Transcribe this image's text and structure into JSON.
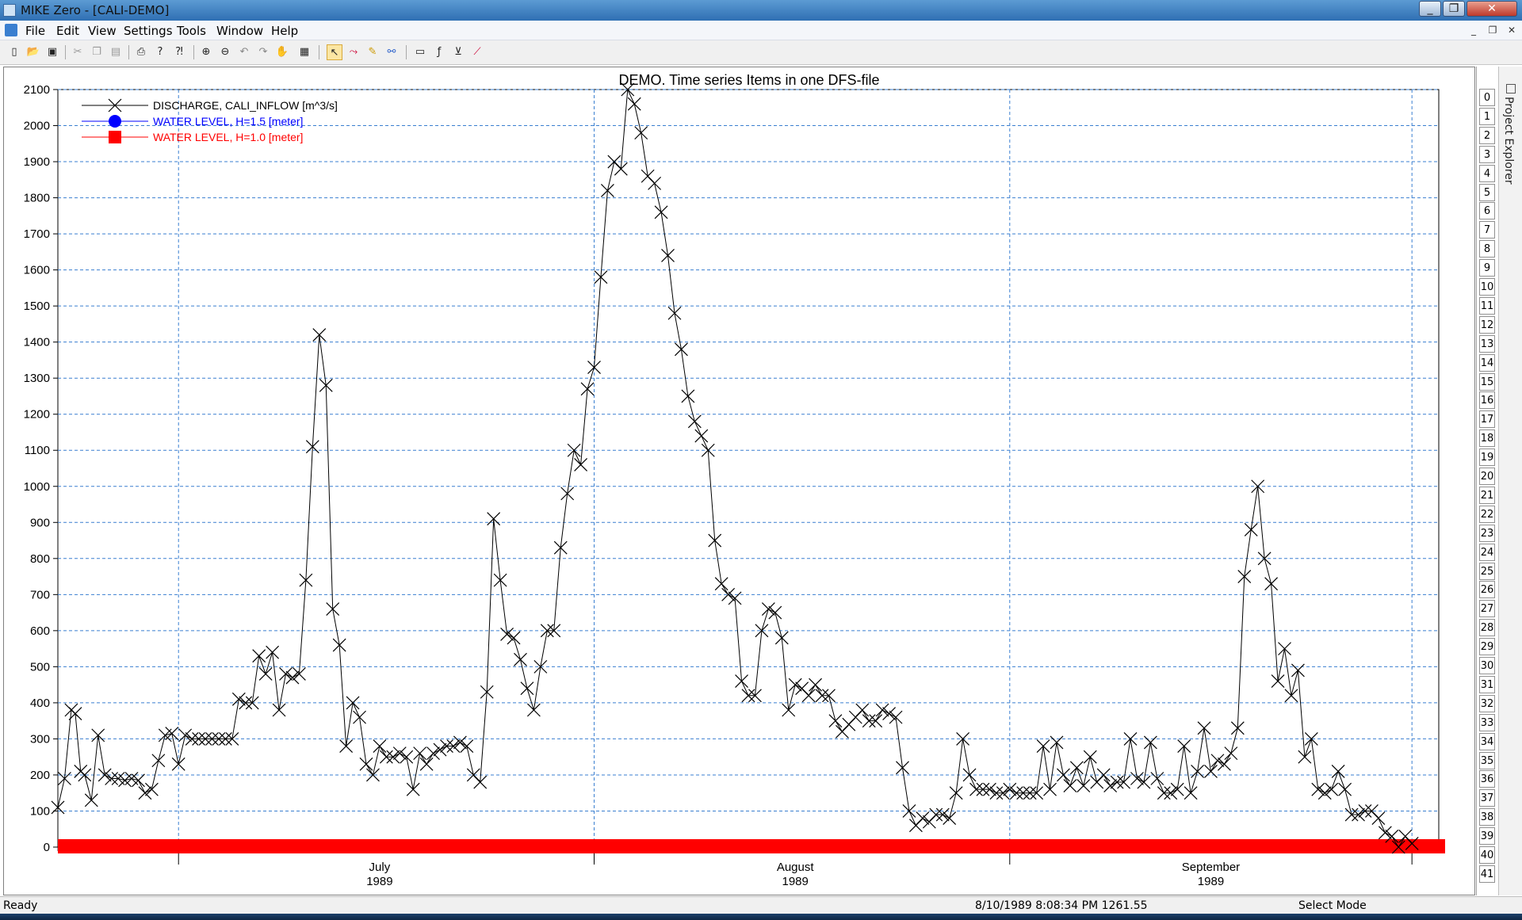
{
  "window": {
    "title": "MIKE Zero - [CALI-DEMO]"
  },
  "menu": [
    "File",
    "Edit",
    "View",
    "Settings",
    "Tools",
    "Window",
    "Help"
  ],
  "toolbar_icons": [
    "new-file-icon",
    "open-folder-icon",
    "save-icon",
    "cut-icon",
    "copy-icon",
    "paste-icon",
    "print-icon",
    "help-icon",
    "context-help-icon",
    "zoom-in-icon",
    "zoom-out-icon",
    "zoom-previous-icon",
    "zoom-next-icon",
    "pan-hand-icon",
    "grid-icon",
    "select-arrow-icon",
    "edit-points-icon",
    "draw-icon",
    "link-icon",
    "rectangle-icon",
    "function-icon",
    "value-icon",
    "line-tool-icon"
  ],
  "right_panel": {
    "rows": [
      "0",
      "1",
      "2",
      "3",
      "4",
      "5",
      "6",
      "7",
      "8",
      "9",
      "10",
      "11",
      "12",
      "13",
      "14",
      "15",
      "16",
      "17",
      "18",
      "19",
      "20",
      "21",
      "22",
      "23",
      "24",
      "25",
      "26",
      "27",
      "28",
      "29",
      "30",
      "31",
      "32",
      "33",
      "34",
      "35",
      "36",
      "37",
      "38",
      "39",
      "40",
      "41"
    ],
    "label": "Project Explorer"
  },
  "status": {
    "left": "Ready",
    "cursor": "8/10/1989 8:08:34 PM 1261.55",
    "mode": "Select Mode"
  },
  "chart_data": {
    "type": "line",
    "title": "DEMO. Time series Items in one DFS-file",
    "x_axis": {
      "start": "1989-06-22",
      "end": "1989-10-03",
      "ticks": [
        {
          "label": "July",
          "sub": "1989"
        },
        {
          "label": "August",
          "sub": "1989"
        },
        {
          "label": "September",
          "sub": "1989"
        }
      ]
    },
    "ylim": [
      0,
      2100
    ],
    "yticks": [
      0,
      100,
      200,
      300,
      400,
      500,
      600,
      700,
      800,
      900,
      1000,
      1100,
      1200,
      1300,
      1400,
      1500,
      1600,
      1700,
      1800,
      1900,
      2000,
      2100
    ],
    "grid": true,
    "legend_position": "top-left",
    "series": [
      {
        "name": "DISCHARGE, CALI_INFLOW [m^3/s]",
        "color": "#000000",
        "marker": "x",
        "x": [
          0,
          0.5,
          1,
          1.3,
          1.7,
          2,
          2.5,
          3,
          3.5,
          4,
          4.5,
          5,
          5.5,
          6,
          6.5,
          7,
          7.5,
          8,
          8.5,
          9,
          9.5,
          10,
          10.5,
          11,
          11.5,
          12,
          12.5,
          13,
          13.5,
          14,
          14.5,
          15,
          15.5,
          16,
          16.5,
          17,
          17.5,
          18,
          18.5,
          19,
          19.5,
          20,
          20.5,
          21,
          21.5,
          22,
          22.5,
          23,
          23.5,
          24,
          24.5,
          25,
          25.5,
          26,
          26.5,
          27,
          27.5,
          28,
          28.5,
          29,
          29.5,
          30,
          30.5,
          31,
          31.5,
          32,
          32.5,
          33,
          33.5,
          34,
          34.5,
          35,
          35.5,
          36,
          36.5,
          37,
          37.5,
          38,
          38.5,
          39,
          39.5,
          40,
          40.5,
          41,
          41.5,
          42,
          42.5,
          43,
          43.5,
          44,
          44.5,
          45,
          45.5,
          46,
          46.5,
          47,
          47.5,
          48,
          48.5,
          49,
          49.5,
          50,
          50.5,
          51,
          51.5,
          52,
          52.5,
          53,
          53.5,
          54,
          54.5,
          55,
          55.5,
          56,
          56.5,
          57,
          57.5,
          58,
          58.5,
          59,
          59.5,
          60,
          60.5,
          61,
          61.5,
          62,
          62.5,
          63,
          63.5,
          64,
          64.5,
          65,
          65.5,
          66,
          66.5,
          67,
          67.5,
          68,
          68.5,
          69,
          69.5,
          70,
          70.5,
          71,
          71.5,
          72,
          72.5,
          73,
          73.5,
          74,
          74.5,
          75,
          75.5,
          76,
          76.5,
          77,
          77.5,
          78,
          78.5,
          79,
          79.5,
          80,
          80.5,
          81,
          81.5,
          82,
          82.5,
          83,
          83.5,
          84,
          84.5,
          85,
          85.5,
          86,
          86.5,
          87,
          87.5,
          88,
          88.5,
          89,
          89.5,
          90,
          90.5,
          91,
          91.5,
          92,
          92.5,
          93,
          93.5,
          94,
          94.5,
          95,
          95.5,
          96,
          96.5,
          97,
          97.5,
          98,
          98.5,
          99,
          99.5,
          100,
          100.5,
          101
        ],
        "y": [
          110,
          190,
          380,
          370,
          210,
          200,
          130,
          310,
          200,
          190,
          190,
          185,
          190,
          185,
          150,
          160,
          240,
          310,
          315,
          230,
          310,
          300,
          300,
          300,
          300,
          300,
          300,
          300,
          410,
          400,
          400,
          530,
          480,
          540,
          380,
          480,
          470,
          480,
          740,
          1110,
          1420,
          1280,
          660,
          560,
          280,
          400,
          360,
          230,
          200,
          280,
          250,
          250,
          260,
          250,
          160,
          260,
          230,
          260,
          270,
          280,
          280,
          290,
          280,
          200,
          180,
          430,
          910,
          740,
          590,
          580,
          520,
          440,
          380,
          500,
          600,
          600,
          830,
          980,
          1100,
          1060,
          1270,
          1330,
          1580,
          1820,
          1900,
          1880,
          2100,
          2060,
          1980,
          1860,
          1840,
          1760,
          1640,
          1480,
          1380,
          1250,
          1180,
          1140,
          1100,
          850,
          730,
          700,
          690,
          460,
          420,
          420,
          600,
          660,
          650,
          580,
          380,
          450,
          440,
          420,
          450,
          420,
          420,
          350,
          320,
          340,
          360,
          380,
          350,
          350,
          380,
          370,
          360,
          220,
          100,
          60,
          80,
          70,
          90,
          90,
          80,
          150,
          300,
          200,
          160,
          160,
          160,
          150,
          150,
          160,
          150,
          150,
          150,
          150,
          280,
          160,
          290,
          200,
          170,
          220,
          170,
          250,
          180,
          200,
          170,
          180,
          180,
          300,
          190,
          180,
          290,
          190,
          150,
          150,
          160,
          280,
          150,
          210,
          330,
          210,
          240,
          230,
          260,
          330,
          750,
          880,
          1000,
          800,
          730,
          460,
          550,
          420,
          490,
          250,
          300,
          160,
          150,
          160,
          210,
          160,
          90,
          90,
          100,
          100,
          80,
          40,
          30,
          0,
          30,
          10
        ]
      },
      {
        "name": "WATER LEVEL, H=1.5 [meter]",
        "color": "#0000ff",
        "marker": "circle",
        "x": [],
        "y": []
      },
      {
        "name": "WATER LEVEL, H=1.0 [meter]",
        "color": "#ff0000",
        "marker": "square",
        "x": [],
        "y": []
      }
    ]
  }
}
